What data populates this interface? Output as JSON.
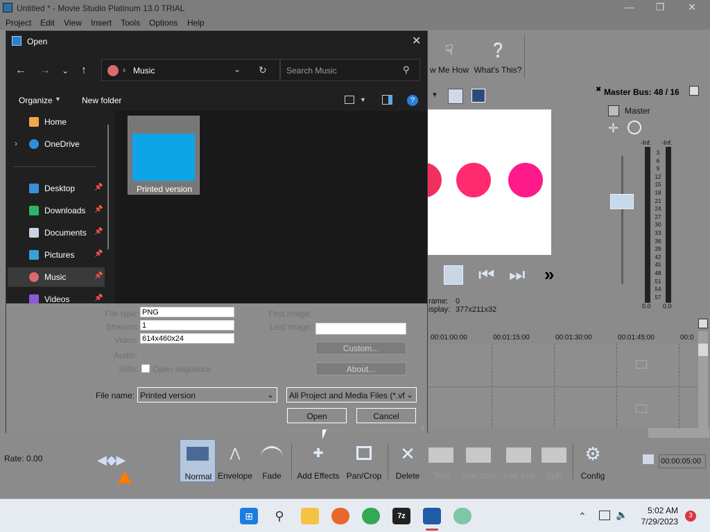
{
  "app": {
    "title": "Untitled * - Movie Studio Platinum 13.0 TRIAL",
    "menu": [
      "Project",
      "Edit",
      "View",
      "Insert",
      "Tools",
      "Options",
      "Help"
    ],
    "toolbar": {
      "show_me_how": "w Me How",
      "whats_this": "What's This?"
    },
    "master_bus": {
      "title": "Master Bus: 48 / 16",
      "label": "Master",
      "inf_left": "-Inf.",
      "inf_right": "-Inf.",
      "scale": [
        "3",
        "6",
        "9",
        "12",
        "15",
        "18",
        "21",
        "24",
        "27",
        "30",
        "33",
        "36",
        "39",
        "42",
        "45",
        "48",
        "51",
        "54",
        "57"
      ],
      "zero_left": "0.0",
      "zero_right": "0.0"
    },
    "preview_info": {
      "frame_label": "rame:",
      "frame_val": "0",
      "display_label": "isplay:",
      "display_val": "377x211x32"
    },
    "timeline": {
      "ticks": [
        "00:01:00:00",
        "00:01:15:00",
        "00:01:30:00",
        "00:01:45:00",
        "00:0"
      ]
    },
    "bottom": {
      "rate": "Rate: 0.00",
      "normal": "Normal",
      "envelope": "Envelope",
      "fade": "Fade",
      "add_effects": "Add Effects",
      "pan_crop": "Pan/Crop",
      "delete": "Delete",
      "trim": "Trim",
      "trim_start": "Trim Start",
      "trim_end": "Trim End",
      "split": "Split",
      "config": "Config",
      "time": "00:00:05:00"
    },
    "colors": {
      "accent": "#0ea4e8",
      "dot1": "#f0315d",
      "dot2": "#ff2b6e",
      "dot3": "#ff1a8a"
    }
  },
  "dialog": {
    "title": "Open",
    "address": {
      "location": "Music"
    },
    "search_placeholder": "Search Music",
    "organize": "Organize",
    "new_folder": "New folder",
    "nav": [
      {
        "label": "Home",
        "icon": "home-icon"
      },
      {
        "label": "OneDrive",
        "icon": "cloud-icon"
      },
      {
        "label": "Desktop",
        "icon": "desktop-icon"
      },
      {
        "label": "Downloads",
        "icon": "download-icon"
      },
      {
        "label": "Documents",
        "icon": "document-icon"
      },
      {
        "label": "Pictures",
        "icon": "pictures-icon"
      },
      {
        "label": "Music",
        "icon": "music-icon"
      },
      {
        "label": "Videos",
        "icon": "videos-icon"
      }
    ],
    "file": {
      "name": "Printed version"
    },
    "info": {
      "file_type_label": "File type:",
      "file_type": "PNG",
      "streams_label": "Streams:",
      "streams": "1",
      "video_label": "Video:",
      "video": "614x460x24",
      "audio_label": "Audio:",
      "stills_label": "Stills:",
      "open_sequence": "Open sequence",
      "first_image_label": "First image:",
      "last_image_label": "Last image:"
    },
    "custom": "Custom...",
    "about": "About...",
    "file_name_label": "File name:",
    "file_name_value": "Printed version",
    "file_type_filter": "All Project and Media Files (*.vf",
    "open": "Open",
    "cancel": "Cancel"
  },
  "taskbar": {
    "time": "5:02 AM",
    "date": "7/29/2023",
    "badge": "3"
  }
}
